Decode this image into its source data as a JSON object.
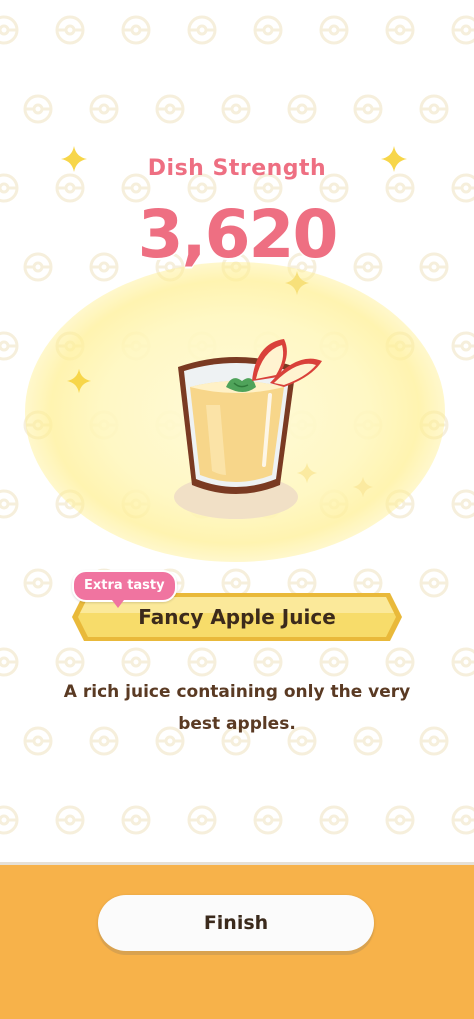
{
  "result": {
    "title": "Dish Strength",
    "strength": "3,620"
  },
  "dish": {
    "badge": "Extra tasty",
    "name": "Fancy Apple Juice",
    "description": "A rich juice containing only the very best apples.",
    "image_icon": "apple-juice-glass-icon"
  },
  "footer": {
    "finish_label": "Finish"
  },
  "colors": {
    "accent_pink": "#ee6f82",
    "badge_pink": "#f074a0",
    "nameplate_yellow": "#f7dc6a",
    "footer_orange": "#f7b24a",
    "text_brown": "#5a3a23"
  }
}
